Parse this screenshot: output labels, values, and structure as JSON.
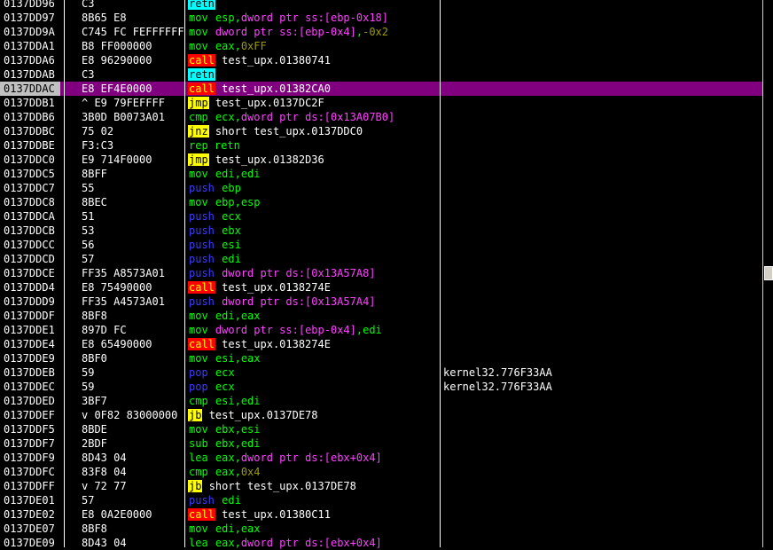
{
  "disassembly": {
    "rows": [
      {
        "addr": "0137DD96",
        "hex": "C3",
        "mnemonic": "retn",
        "mtype": "retn",
        "parts": [],
        "comment": ""
      },
      {
        "addr": "0137DD97",
        "hex": "8B65 E8",
        "mnemonic": "mov",
        "mtype": "mov",
        "parts": [
          {
            "t": "esp,",
            "c": "op"
          },
          {
            "t": "dword ptr ss:[ebp-0x18]",
            "c": "mem"
          }
        ],
        "comment": ""
      },
      {
        "addr": "0137DD9A",
        "hex": "C745 FC FEFFFFFF",
        "mnemonic": "mov",
        "mtype": "mov",
        "parts": [
          {
            "t": "dword ptr ss:[ebp-0x4]",
            "c": "mem"
          },
          {
            "t": ",",
            "c": "op"
          },
          {
            "t": "-0x2",
            "c": "imm"
          }
        ],
        "comment": ""
      },
      {
        "addr": "0137DDA1",
        "hex": "B8 FF000000",
        "mnemonic": "mov",
        "mtype": "mov",
        "parts": [
          {
            "t": "eax,",
            "c": "op"
          },
          {
            "t": "0xFF",
            "c": "imm"
          }
        ],
        "comment": ""
      },
      {
        "addr": "0137DDA6",
        "hex": "E8 96290000",
        "mnemonic": "call",
        "mtype": "call",
        "parts": [
          {
            "t": "test_upx.01380741",
            "c": "plain"
          }
        ],
        "comment": ""
      },
      {
        "addr": "0137DDAB",
        "hex": "C3",
        "mnemonic": "retn",
        "mtype": "retn",
        "parts": [],
        "comment": ""
      },
      {
        "addr": "0137DDAC",
        "hex": "E8 EF4E0000",
        "mnemonic": "call",
        "mtype": "call",
        "parts": [
          {
            "t": "test_upx.01382CA0",
            "c": "plain"
          }
        ],
        "comment": "",
        "selected": true
      },
      {
        "addr": "0137DDB1",
        "hex": "^ E9 79FEFFFF",
        "mnemonic": "jmp",
        "mtype": "jmp",
        "parts": [
          {
            "t": "test_upx.0137DC2F",
            "c": "plain"
          }
        ],
        "comment": ""
      },
      {
        "addr": "0137DDB6",
        "hex": "3B0D B0073A01",
        "mnemonic": "cmp",
        "mtype": "cmp",
        "parts": [
          {
            "t": "ecx,",
            "c": "op"
          },
          {
            "t": "dword ptr ds:[0x13A07B0]",
            "c": "mem"
          }
        ],
        "comment": ""
      },
      {
        "addr": "0137DDBC",
        "hex": "75 02",
        "mnemonic": "jnz",
        "mtype": "jnz",
        "parts": [
          {
            "t": "short test_upx.0137DDC0",
            "c": "plain"
          }
        ],
        "comment": ""
      },
      {
        "addr": "0137DDBE",
        "hex": "F3:C3",
        "mnemonic": "rep retn",
        "mtype": "rep",
        "parts": [],
        "comment": ""
      },
      {
        "addr": "0137DDC0",
        "hex": "E9 714F0000",
        "mnemonic": "jmp",
        "mtype": "jmp",
        "parts": [
          {
            "t": "test_upx.01382D36",
            "c": "plain"
          }
        ],
        "comment": ""
      },
      {
        "addr": "0137DDC5",
        "hex": "8BFF",
        "mnemonic": "mov",
        "mtype": "mov",
        "parts": [
          {
            "t": "edi,edi",
            "c": "op"
          }
        ],
        "comment": ""
      },
      {
        "addr": "0137DDC7",
        "hex": "55",
        "mnemonic": "push",
        "mtype": "push",
        "parts": [
          {
            "t": "ebp",
            "c": "op"
          }
        ],
        "comment": ""
      },
      {
        "addr": "0137DDC8",
        "hex": "8BEC",
        "mnemonic": "mov",
        "mtype": "mov",
        "parts": [
          {
            "t": "ebp,esp",
            "c": "op"
          }
        ],
        "comment": ""
      },
      {
        "addr": "0137DDCA",
        "hex": "51",
        "mnemonic": "push",
        "mtype": "push",
        "parts": [
          {
            "t": "ecx",
            "c": "op"
          }
        ],
        "comment": ""
      },
      {
        "addr": "0137DDCB",
        "hex": "53",
        "mnemonic": "push",
        "mtype": "push",
        "parts": [
          {
            "t": "ebx",
            "c": "op"
          }
        ],
        "comment": ""
      },
      {
        "addr": "0137DDCC",
        "hex": "56",
        "mnemonic": "push",
        "mtype": "push",
        "parts": [
          {
            "t": "esi",
            "c": "op"
          }
        ],
        "comment": ""
      },
      {
        "addr": "0137DDCD",
        "hex": "57",
        "mnemonic": "push",
        "mtype": "push",
        "parts": [
          {
            "t": "edi",
            "c": "op"
          }
        ],
        "comment": ""
      },
      {
        "addr": "0137DDCE",
        "hex": "FF35 A8573A01",
        "mnemonic": "push",
        "mtype": "push",
        "parts": [
          {
            "t": "dword ptr ds:[0x13A57A8]",
            "c": "mem"
          }
        ],
        "comment": ""
      },
      {
        "addr": "0137DDD4",
        "hex": "E8 75490000",
        "mnemonic": "call",
        "mtype": "call",
        "parts": [
          {
            "t": "test_upx.0138274E",
            "c": "plain"
          }
        ],
        "comment": ""
      },
      {
        "addr": "0137DDD9",
        "hex": "FF35 A4573A01",
        "mnemonic": "push",
        "mtype": "push",
        "parts": [
          {
            "t": "dword ptr ds:[0x13A57A4]",
            "c": "mem"
          }
        ],
        "comment": ""
      },
      {
        "addr": "0137DDDF",
        "hex": "8BF8",
        "mnemonic": "mov",
        "mtype": "mov",
        "parts": [
          {
            "t": "edi,eax",
            "c": "op"
          }
        ],
        "comment": ""
      },
      {
        "addr": "0137DDE1",
        "hex": "897D FC",
        "mnemonic": "mov",
        "mtype": "mov",
        "parts": [
          {
            "t": "dword ptr ss:[ebp-0x4]",
            "c": "mem"
          },
          {
            "t": ",edi",
            "c": "op"
          }
        ],
        "comment": ""
      },
      {
        "addr": "0137DDE4",
        "hex": "E8 65490000",
        "mnemonic": "call",
        "mtype": "call",
        "parts": [
          {
            "t": "test_upx.0138274E",
            "c": "plain"
          }
        ],
        "comment": ""
      },
      {
        "addr": "0137DDE9",
        "hex": "8BF0",
        "mnemonic": "mov",
        "mtype": "mov",
        "parts": [
          {
            "t": "esi,eax",
            "c": "op"
          }
        ],
        "comment": ""
      },
      {
        "addr": "0137DDEB",
        "hex": "59",
        "mnemonic": "pop",
        "mtype": "pop",
        "parts": [
          {
            "t": "ecx",
            "c": "op"
          }
        ],
        "comment": "kernel32.776F33AA"
      },
      {
        "addr": "0137DDEC",
        "hex": "59",
        "mnemonic": "pop",
        "mtype": "pop",
        "parts": [
          {
            "t": "ecx",
            "c": "op"
          }
        ],
        "comment": "kernel32.776F33AA"
      },
      {
        "addr": "0137DDED",
        "hex": "3BF7",
        "mnemonic": "cmp",
        "mtype": "cmp",
        "parts": [
          {
            "t": "esi,edi",
            "c": "op"
          }
        ],
        "comment": ""
      },
      {
        "addr": "0137DDEF",
        "hex": "v 0F82 83000000",
        "mnemonic": "jb",
        "mtype": "jb",
        "parts": [
          {
            "t": "test_upx.0137DE78",
            "c": "plain"
          }
        ],
        "comment": ""
      },
      {
        "addr": "0137DDF5",
        "hex": "8BDE",
        "mnemonic": "mov",
        "mtype": "mov",
        "parts": [
          {
            "t": "ebx,esi",
            "c": "op"
          }
        ],
        "comment": ""
      },
      {
        "addr": "0137DDF7",
        "hex": "2BDF",
        "mnemonic": "sub",
        "mtype": "sub",
        "parts": [
          {
            "t": "ebx,edi",
            "c": "op"
          }
        ],
        "comment": ""
      },
      {
        "addr": "0137DDF9",
        "hex": "8D43 04",
        "mnemonic": "lea",
        "mtype": "lea",
        "parts": [
          {
            "t": "eax,",
            "c": "op"
          },
          {
            "t": "dword ptr ds:[ebx+0x4]",
            "c": "mem"
          }
        ],
        "comment": ""
      },
      {
        "addr": "0137DDFC",
        "hex": "83F8 04",
        "mnemonic": "cmp",
        "mtype": "cmp",
        "parts": [
          {
            "t": "eax,",
            "c": "op"
          },
          {
            "t": "0x4",
            "c": "imm"
          }
        ],
        "comment": ""
      },
      {
        "addr": "0137DDFF",
        "hex": "v 72 77",
        "mnemonic": "jb",
        "mtype": "jb",
        "parts": [
          {
            "t": "short test_upx.0137DE78",
            "c": "plain"
          }
        ],
        "comment": ""
      },
      {
        "addr": "0137DE01",
        "hex": "57",
        "mnemonic": "push",
        "mtype": "push",
        "parts": [
          {
            "t": "edi",
            "c": "op"
          }
        ],
        "comment": ""
      },
      {
        "addr": "0137DE02",
        "hex": "E8 0A2E0000",
        "mnemonic": "call",
        "mtype": "call",
        "parts": [
          {
            "t": "test_upx.01380C11",
            "c": "plain"
          }
        ],
        "comment": ""
      },
      {
        "addr": "0137DE07",
        "hex": "8BF8",
        "mnemonic": "mov",
        "mtype": "mov",
        "parts": [
          {
            "t": "edi,eax",
            "c": "op"
          }
        ],
        "comment": ""
      },
      {
        "addr": "0137DE09",
        "hex": "8D43 04",
        "mnemonic": "lea",
        "mtype": "lea",
        "parts": [
          {
            "t": "eax,",
            "c": "op"
          },
          {
            "t": "dword ptr ds:[ebx+0x4]",
            "c": "mem"
          }
        ],
        "comment": ""
      }
    ]
  },
  "colors": {
    "background": "#000000",
    "selected_row": "#800080",
    "call_bg": "#ff0000",
    "jump_bg": "#ffff00",
    "retn_bg": "#00ffff",
    "register": "#00ff00",
    "memory": "#ff40ff",
    "immediate": "#9c9c00",
    "push_pop": "#3a3aff"
  }
}
